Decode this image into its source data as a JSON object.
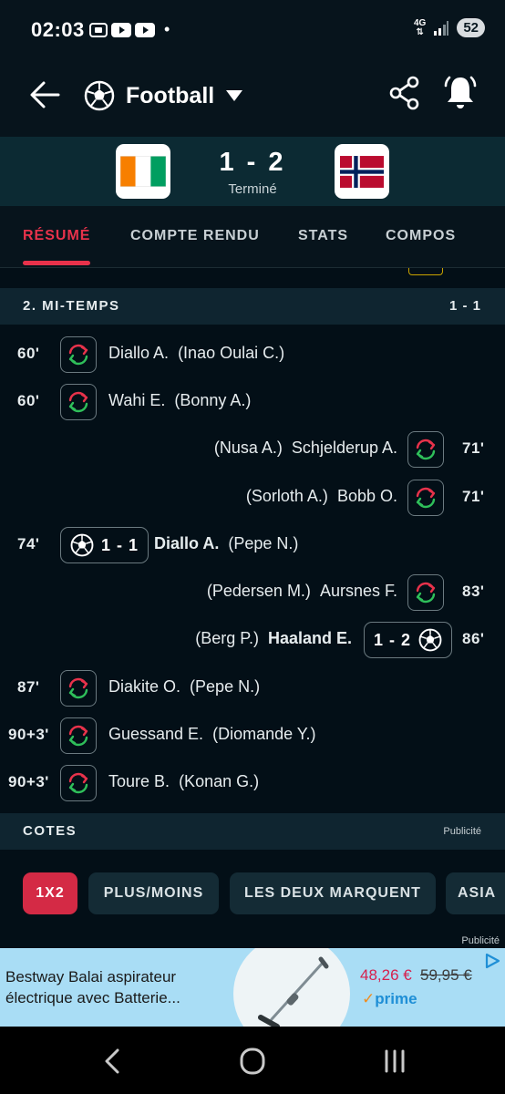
{
  "status_bar": {
    "time": "02:03",
    "dot": "•",
    "network_top": "4G",
    "network_bottom": "⇅",
    "battery": "52"
  },
  "header": {
    "sport": "Football",
    "icons": [
      "back-arrow-icon",
      "soccer-ball-icon",
      "dropdown-caret-icon",
      "share-icon",
      "bell-alert-icon"
    ]
  },
  "match": {
    "home_flag": "Côte d'Ivoire",
    "away_flag": "Norway",
    "score": "1 - 2",
    "status": "Terminé"
  },
  "tabs": {
    "items": [
      {
        "label": "RÉSUMÉ",
        "active": true
      },
      {
        "label": "COMPTE RENDU",
        "active": false
      },
      {
        "label": "STATS",
        "active": false
      },
      {
        "label": "COMPOS",
        "active": false
      }
    ]
  },
  "second_half": {
    "title": "2. MI-TEMPS",
    "score": "1 - 1",
    "events": [
      {
        "minute": "60'",
        "type": "sub",
        "side": "home",
        "player": "Diallo A.",
        "assist": "(Inao Oulai C.)"
      },
      {
        "minute": "60'",
        "type": "sub",
        "side": "home",
        "player": "Wahi E.",
        "assist": "(Bonny A.)"
      },
      {
        "minute": "71'",
        "type": "sub",
        "side": "away",
        "player": "Schjelderup A.",
        "assist": "(Nusa A.)"
      },
      {
        "minute": "71'",
        "type": "sub",
        "side": "away",
        "player": "Bobb O.",
        "assist": "(Sorloth A.)"
      },
      {
        "minute": "74'",
        "type": "goal",
        "side": "home",
        "score": "1 - 1",
        "player": "Diallo A.",
        "assist": "(Pepe N.)"
      },
      {
        "minute": "83'",
        "type": "sub",
        "side": "away",
        "player": "Aursnes F.",
        "assist": "(Pedersen M.)"
      },
      {
        "minute": "86'",
        "type": "goal",
        "side": "away",
        "score": "1 - 2",
        "player": "Haaland E.",
        "assist": "(Berg P.)"
      },
      {
        "minute": "87'",
        "type": "sub",
        "side": "home",
        "player": "Diakite O.",
        "assist": "(Pepe N.)"
      },
      {
        "minute": "90+3'",
        "type": "sub",
        "side": "home",
        "player": "Guessand E.",
        "assist": "(Diomande Y.)"
      },
      {
        "minute": "90+3'",
        "type": "sub",
        "side": "home",
        "player": "Toure B.",
        "assist": "(Konan G.)"
      }
    ]
  },
  "odds": {
    "title": "COTES",
    "ad_tag": "Publicité",
    "tabs": [
      "1X2",
      "PLUS/MOINS",
      "LES DEUX MARQUENT",
      "ASIA"
    ]
  },
  "ad": {
    "label": "Publicité",
    "title": "Bestway Balai aspirateur électrique avec Batterie...",
    "price": "48,26 €",
    "old_price": "59,95 €",
    "prime": "prime"
  },
  "colors": {
    "accent": "#e8324b",
    "background": "#030f17",
    "section": "#0f2530",
    "sub_in": "#2fbf5a",
    "sub_out": "#e8324b"
  }
}
